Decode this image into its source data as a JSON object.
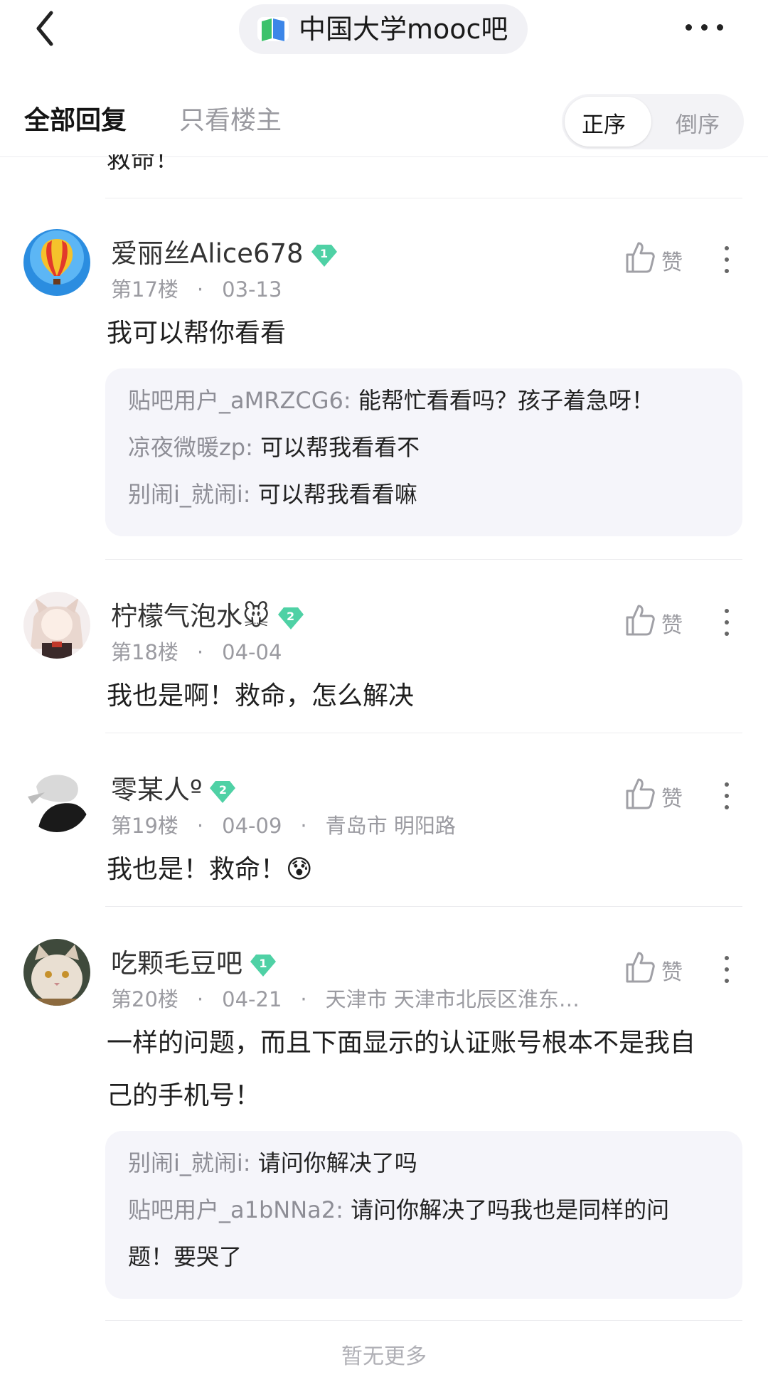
{
  "header": {
    "back_icon": "chevron-left-icon",
    "forum_name": "中国大学mooc吧",
    "forum_logo_icon": "book-icon",
    "more_icon": "more-horizontal-icon"
  },
  "tabs": {
    "all_replies": "全部回复",
    "owner_only": "只看楼主",
    "sort_asc": "正序",
    "sort_desc": "倒序"
  },
  "prev_post_tail": "救命！",
  "posts": [
    {
      "username": "爱丽丝Alice678",
      "level": "1",
      "floor": "第17楼",
      "date": "03-13",
      "location": "",
      "content": "我可以帮你看看",
      "like_label": "赞",
      "replies": [
        {
          "name": "贴吧用户_aMRZCG6:",
          "text": " 能帮忙看看吗？孩子着急呀！"
        },
        {
          "name": "凉夜微暖zp:",
          "text": " 可以帮我看看不"
        },
        {
          "name": "别闹i_就闹i:",
          "text": " 可以帮我看看嘛"
        }
      ]
    },
    {
      "username": "柠檬气泡水🐭",
      "level": "2",
      "floor": "第18楼",
      "date": "04-04",
      "location": "",
      "content": "我也是啊！救命，怎么解决",
      "like_label": "赞"
    },
    {
      "username": "零某人º",
      "level": "2",
      "floor": "第19楼",
      "date": "04-09",
      "location": "青岛市 明阳路",
      "content": "我也是！救命！😰",
      "like_label": "赞"
    },
    {
      "username": "吃颗毛豆吧",
      "level": "1",
      "floor": "第20楼",
      "date": "04-21",
      "location": "天津市 天津市北辰区淮东…",
      "content_line1": "一样的问题，而且下面显示的认证账号根本不是我自",
      "content_line2": "己的手机号！",
      "like_label": "赞",
      "replies": [
        {
          "name": "别闹i_就闹i:",
          "text": " 请问你解决了吗"
        },
        {
          "name": "贴吧用户_a1bNNa2:",
          "text": " 请问你解决了吗我也是同样的问",
          "text2": "题！要哭了"
        }
      ]
    }
  ],
  "footer": {
    "no_more": "暂无更多"
  },
  "colors": {
    "badge_green": "#4fd1a5",
    "reply_box": "#f5f5fa",
    "muted_text": "#9b9ba1"
  }
}
